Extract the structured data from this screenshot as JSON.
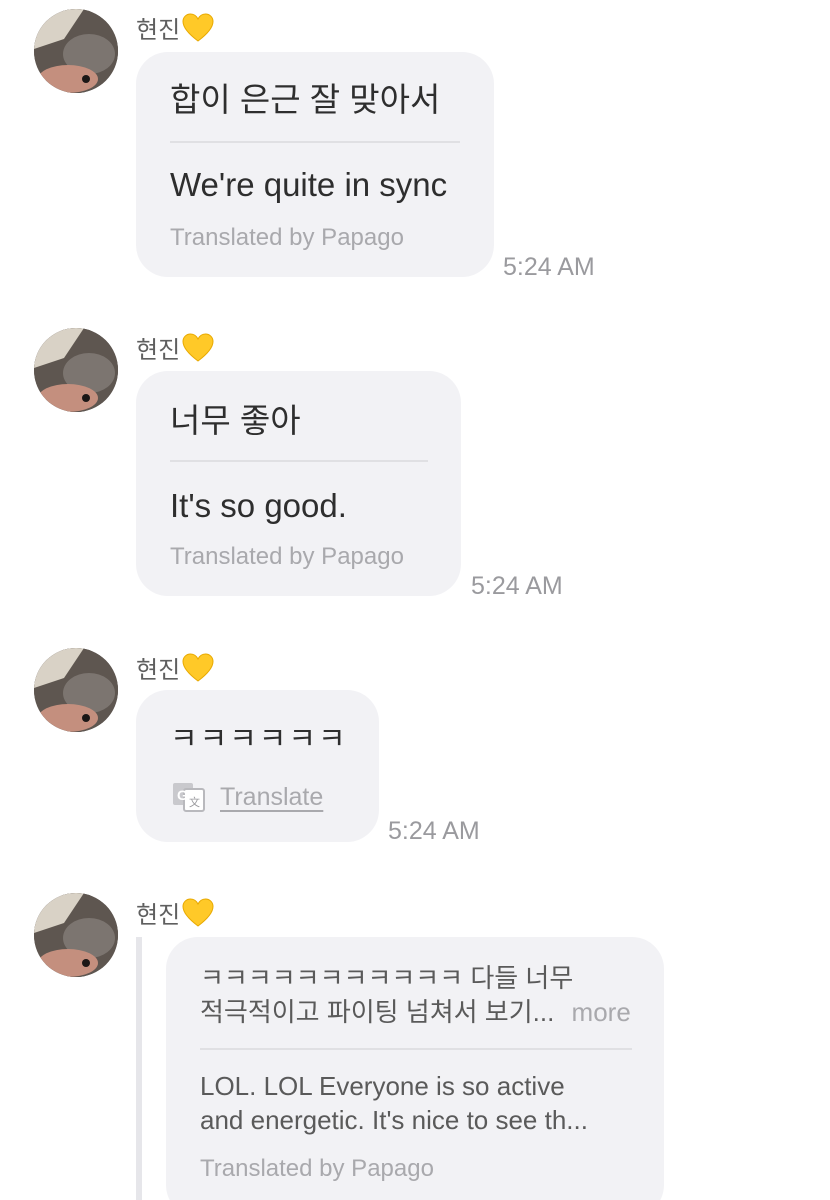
{
  "messages": [
    {
      "sender": "현진",
      "original": "합이 은근 잘 맞아서",
      "translation": "We're quite in sync",
      "translated_by": "Translated by Papago",
      "time": "5:24 AM"
    },
    {
      "sender": "현진",
      "original": "너무 좋아",
      "translation": "It's so good.",
      "translated_by": "Translated by Papago",
      "time": "5:24 AM"
    },
    {
      "sender": "현진",
      "original": "ㅋㅋㅋㅋㅋㅋ",
      "translate_label": "Translate",
      "time": "5:24 AM"
    },
    {
      "sender": "현진",
      "original_line1": "ㅋㅋㅋㅋㅋㅋㅋㅋㅋㅋㅋ 다들 너무",
      "original_line2": "적극적이고 파이팅 넘쳐서 보기...",
      "more_label": "more",
      "translation_line1": "LOL. LOL Everyone is so active",
      "translation_line2": "and energetic. It's nice to see th...",
      "translated_by": "Translated by Papago"
    }
  ],
  "icons": {
    "heart": "yellow-heart-icon",
    "translate": "google-translate-icon"
  },
  "colors": {
    "bubble": "#f2f2f5",
    "heart": "#ffc928",
    "muted_text": "#a9a9ad"
  }
}
